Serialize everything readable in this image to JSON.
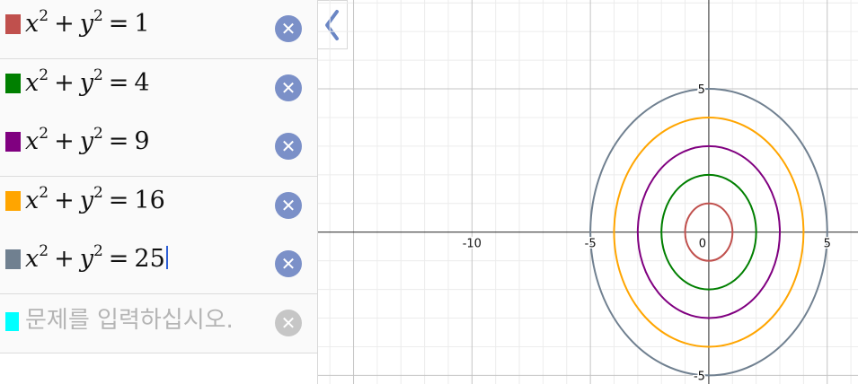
{
  "expressions": [
    {
      "id": "e1",
      "lhs_var1": "x",
      "exp1": "2",
      "op1": "+",
      "lhs_var2": "y",
      "exp2": "2",
      "eq": "=",
      "rhs": "1",
      "color": "#c0504d",
      "r": 1,
      "caret": false
    },
    {
      "id": "e2",
      "lhs_var1": "x",
      "exp1": "2",
      "op1": "+",
      "lhs_var2": "y",
      "exp2": "2",
      "eq": "=",
      "rhs": "4",
      "color": "#007f00",
      "r": 2,
      "caret": false
    },
    {
      "id": "e3",
      "lhs_var1": "x",
      "exp1": "2",
      "op1": "+",
      "lhs_var2": "y",
      "exp2": "2",
      "eq": "=",
      "rhs": "9",
      "color": "#800080",
      "r": 3,
      "caret": false
    },
    {
      "id": "e4",
      "lhs_var1": "x",
      "exp1": "2",
      "op1": "+",
      "lhs_var2": "y",
      "exp2": "2",
      "eq": "=",
      "rhs": "16",
      "color": "#ffa500",
      "r": 4,
      "caret": false
    },
    {
      "id": "e5",
      "lhs_var1": "x",
      "exp1": "2",
      "op1": "+",
      "lhs_var2": "y",
      "exp2": "2",
      "eq": "=",
      "rhs": "25",
      "color": "#708090",
      "r": 5,
      "caret": true
    }
  ],
  "new_expression": {
    "placeholder": "문제를 입력하십시오.",
    "color": "#00ffff"
  },
  "delete_icon_label": "✕",
  "delete_color_active": "#7b90c8",
  "delete_color_inactive": "#c6c6c6",
  "collapse_icon": "chevron-left-icon",
  "graph": {
    "x_min": -16.5,
    "x_max": 6.3,
    "y_min": -5.3,
    "y_max": 8.1,
    "minor_step": 1,
    "major_step": 5,
    "x_tick_labels": [
      {
        "v": -10,
        "t": "-10"
      },
      {
        "v": -5,
        "t": "-5"
      },
      {
        "v": 0,
        "t": "0"
      },
      {
        "v": 5,
        "t": "5"
      }
    ],
    "y_tick_labels": [
      {
        "v": 5,
        "t": "5"
      },
      {
        "v": -5,
        "t": "-5"
      }
    ]
  }
}
